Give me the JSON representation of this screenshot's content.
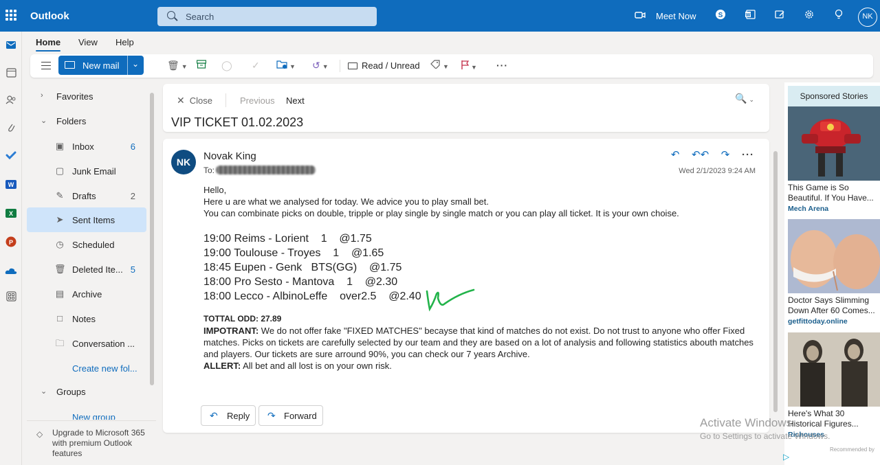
{
  "app": {
    "title": "Outlook",
    "search_placeholder": "Search",
    "meet_now": "Meet Now",
    "user_initials": "NK"
  },
  "ribbon": {
    "tabs": [
      "Home",
      "View",
      "Help"
    ],
    "new_mail": "New mail",
    "read_unread": "Read / Unread"
  },
  "nav": {
    "favorites": "Favorites",
    "folders": "Folders",
    "items": [
      {
        "label": "Inbox",
        "count": "6"
      },
      {
        "label": "Junk Email",
        "count": ""
      },
      {
        "label": "Drafts",
        "count": "2"
      },
      {
        "label": "Sent Items",
        "count": ""
      },
      {
        "label": "Scheduled",
        "count": ""
      },
      {
        "label": "Deleted Ite...",
        "count": "5"
      },
      {
        "label": "Archive",
        "count": ""
      },
      {
        "label": "Notes",
        "count": ""
      },
      {
        "label": "Conversation ...",
        "count": ""
      }
    ],
    "create_folder": "Create new fol...",
    "groups": "Groups",
    "new_group": "New group",
    "upgrade": "Upgrade to Microsoft 365 with premium Outlook features"
  },
  "reading": {
    "close": "Close",
    "previous": "Previous",
    "next": "Next",
    "subject": "VIP TICKET 01.02.2023"
  },
  "message": {
    "avatar": "NK",
    "sender": "Novak King",
    "to_label": "To:",
    "date": "Wed 2/1/2023 9:24 AM",
    "greeting": "Hello,",
    "line1": "Here u are what we analysed for today. We advice you to play small bet.",
    "line2": "You can combinate picks on double, tripple or play single by single match or you can play all ticket. It is your own choise.",
    "picks": [
      "19:00 Reims - Lorient    1    @1.75",
      "19:00 Toulouse - Troyes    1    @1.65",
      "18:45 Eupen - Genk   BTS(GG)    @1.75",
      "18:00 Pro Sesto - Mantova    1    @2.30",
      "18:00 Lecco - AlbinoLeffe    over2.5    @2.40"
    ],
    "total_odd": "TOTTAL ODD: 27.89",
    "important_label": "IMPOTRANT:",
    "important_text": " We do not offer fake \"FIXED MATCHES\" becayse that kind of matches do not exist. Do not trust to anyone who offer Fixed matches. Picks on tickets are carefully selected by our team and they are based on a lot of analysis and following statistics abouth matches and players. Our tickets are sure arround 90%, you can check our 7 years Archive.",
    "allert_label": "ALLERT:",
    "allert_text": " All bet and all lost is on your own risk.",
    "reply": "Reply",
    "forward": "Forward"
  },
  "ads": {
    "header": "Sponsored Stories",
    "items": [
      {
        "title": "This Game is So Beautiful. If You Have...",
        "source": "Mech Arena"
      },
      {
        "title": "Doctor Says Slimming Down After 60 Comes...",
        "source": "getfittoday.online"
      },
      {
        "title": "Here's What 30 Historical Figures...",
        "source": "Richouses"
      }
    ],
    "recommended": "Recommended by"
  },
  "watermark": {
    "line1": "Activate Windows",
    "line2": "Go to Settings to activate Windows."
  },
  "colors": {
    "brand": "#0f6cbd",
    "selected": "#cfe4fa",
    "avatar": "#0f4c81"
  }
}
